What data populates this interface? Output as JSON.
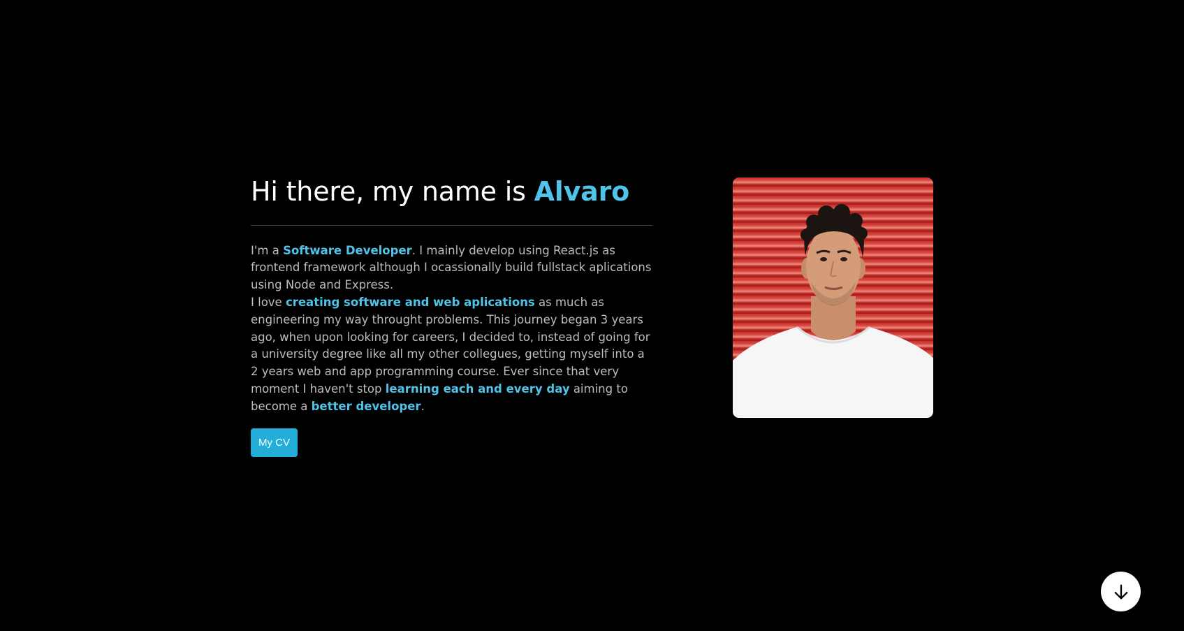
{
  "hero": {
    "title_prefix": "Hi there, my name is ",
    "title_name": "Alvaro",
    "bio": {
      "p1_start": "I'm a ",
      "p1_highlight": "Software Developer",
      "p1_rest": ". I mainly develop using React.js as frontend framework although I ocassionally build fullstack aplications using Node and Express.",
      "p2_start": "I love ",
      "p2_highlight1": "creating software and web aplications",
      "p2_middle": " as much as engineering my way throught problems. This journey began 3 years ago, when upon looking for careers, I decided to, instead of going for a university degree like all my other collegues, getting myself into a 2 years web and app programming course. Ever since that very moment I haven't stop ",
      "p2_highlight2": "learning each and every day",
      "p2_middle2": " aiming to become a ",
      "p2_highlight3": "better developer",
      "p2_end": "."
    },
    "cv_button_label": "My CV"
  },
  "icons": {
    "scroll_down": "arrow-down-icon"
  },
  "colors": {
    "background": "#000000",
    "accent": "#4fc3e8",
    "button": "#22aed8",
    "body_text": "#bdbdbd"
  }
}
